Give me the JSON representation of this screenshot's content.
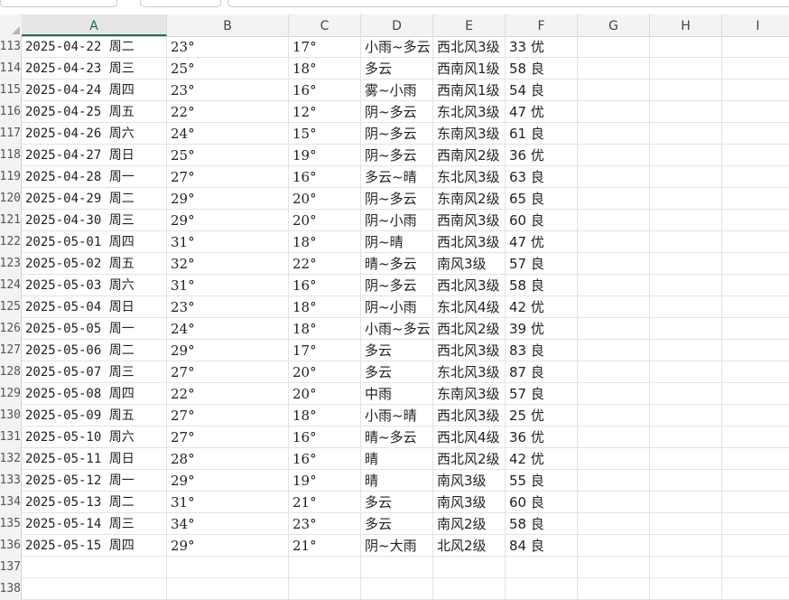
{
  "columns": [
    "A",
    "B",
    "C",
    "D",
    "E",
    "F",
    "G",
    "H",
    "I"
  ],
  "rows": [
    {
      "num": "113",
      "a": "2025-04-22 周二",
      "b": "23°",
      "c": "17°",
      "d": "小雨~多云",
      "e": "西北风3级",
      "f": "33 优"
    },
    {
      "num": "114",
      "a": "2025-04-23 周三",
      "b": "25°",
      "c": "18°",
      "d": "多云",
      "e": "西南风1级",
      "f": "58 良"
    },
    {
      "num": "115",
      "a": "2025-04-24 周四",
      "b": "23°",
      "c": "16°",
      "d": "雾~小雨",
      "e": "西南风1级",
      "f": "54 良"
    },
    {
      "num": "116",
      "a": "2025-04-25 周五",
      "b": "22°",
      "c": "12°",
      "d": "阴~多云",
      "e": "东北风3级",
      "f": "47 优"
    },
    {
      "num": "117",
      "a": "2025-04-26 周六",
      "b": "24°",
      "c": "15°",
      "d": "阴~多云",
      "e": "东南风3级",
      "f": "61 良"
    },
    {
      "num": "118",
      "a": "2025-04-27 周日",
      "b": "25°",
      "c": "19°",
      "d": "阴~多云",
      "e": "西南风2级",
      "f": "36 优"
    },
    {
      "num": "119",
      "a": "2025-04-28 周一",
      "b": "27°",
      "c": "16°",
      "d": "多云~晴",
      "e": "东北风3级",
      "f": "63 良"
    },
    {
      "num": "120",
      "a": "2025-04-29 周二",
      "b": "29°",
      "c": "20°",
      "d": "阴~多云",
      "e": "东南风2级",
      "f": "65 良"
    },
    {
      "num": "121",
      "a": "2025-04-30 周三",
      "b": "29°",
      "c": "20°",
      "d": "阴~小雨",
      "e": "西南风3级",
      "f": "60 良"
    },
    {
      "num": "122",
      "a": "2025-05-01 周四",
      "b": "31°",
      "c": "18°",
      "d": "阴~晴",
      "e": "西北风3级",
      "f": "47 优"
    },
    {
      "num": "123",
      "a": "2025-05-02 周五",
      "b": "32°",
      "c": "22°",
      "d": "晴~多云",
      "e": "南风3级",
      "f": "57 良"
    },
    {
      "num": "124",
      "a": "2025-05-03 周六",
      "b": "31°",
      "c": "16°",
      "d": "阴~多云",
      "e": "西北风3级",
      "f": "58 良"
    },
    {
      "num": "125",
      "a": "2025-05-04 周日",
      "b": "23°",
      "c": "18°",
      "d": "阴~小雨",
      "e": "东北风4级",
      "f": "42 优"
    },
    {
      "num": "126",
      "a": "2025-05-05 周一",
      "b": "24°",
      "c": "18°",
      "d": "小雨~多云",
      "e": "西北风2级",
      "f": "39 优"
    },
    {
      "num": "127",
      "a": "2025-05-06 周二",
      "b": "29°",
      "c": "17°",
      "d": "多云",
      "e": "西北风3级",
      "f": "83 良"
    },
    {
      "num": "128",
      "a": "2025-05-07 周三",
      "b": "27°",
      "c": "20°",
      "d": "多云",
      "e": "东北风3级",
      "f": "87 良"
    },
    {
      "num": "129",
      "a": "2025-05-08 周四",
      "b": "22°",
      "c": "20°",
      "d": "中雨",
      "e": "东南风3级",
      "f": "57 良"
    },
    {
      "num": "130",
      "a": "2025-05-09 周五",
      "b": "27°",
      "c": "18°",
      "d": "小雨~晴",
      "e": "西北风3级",
      "f": "25 优"
    },
    {
      "num": "131",
      "a": "2025-05-10 周六",
      "b": "27°",
      "c": "16°",
      "d": "晴~多云",
      "e": "西北风4级",
      "f": "36 优"
    },
    {
      "num": "132",
      "a": "2025-05-11 周日",
      "b": "28°",
      "c": "16°",
      "d": "晴",
      "e": "西北风2级",
      "f": "42 优"
    },
    {
      "num": "133",
      "a": "2025-05-12 周一",
      "b": "29°",
      "c": "19°",
      "d": "晴",
      "e": "南风3级",
      "f": "55 良"
    },
    {
      "num": "134",
      "a": "2025-05-13 周二",
      "b": "31°",
      "c": "21°",
      "d": "多云",
      "e": "南风3级",
      "f": "60 良"
    },
    {
      "num": "135",
      "a": "2025-05-14 周三",
      "b": "34°",
      "c": "23°",
      "d": "多云",
      "e": "南风2级",
      "f": "58 良"
    },
    {
      "num": "136",
      "a": "2025-05-15 周四",
      "b": "29°",
      "c": "21°",
      "d": "阴~大雨",
      "e": "北风2级",
      "f": "84 良"
    },
    {
      "num": "137",
      "a": "",
      "b": "",
      "c": "",
      "d": "",
      "e": "",
      "f": ""
    },
    {
      "num": "138",
      "a": "",
      "b": "",
      "c": "",
      "d": "",
      "e": "",
      "f": ""
    }
  ]
}
